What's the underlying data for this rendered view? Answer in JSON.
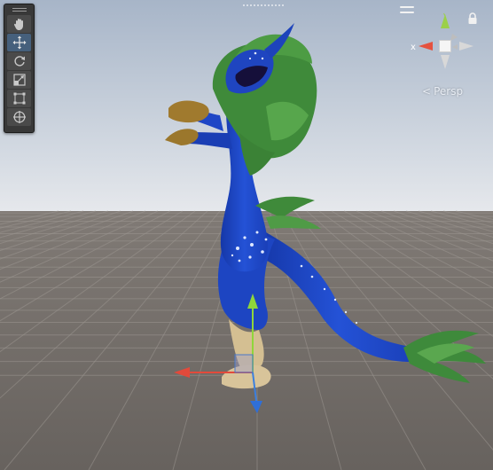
{
  "tools": {
    "items": [
      {
        "name": "hand-tool",
        "icon": "hand-icon",
        "active": false
      },
      {
        "name": "move-tool",
        "icon": "move-icon",
        "active": true
      },
      {
        "name": "rotate-tool",
        "icon": "rotate-icon",
        "active": false
      },
      {
        "name": "scale-tool",
        "icon": "scale-icon",
        "active": false
      },
      {
        "name": "rect-tool",
        "icon": "rect-transform-icon",
        "active": false
      },
      {
        "name": "transform-tool",
        "icon": "transform-icon",
        "active": false
      }
    ]
  },
  "gizmo": {
    "x_label": "x",
    "projection_label": "Persp",
    "colors": {
      "x": "#e5523f",
      "y": "#9bd04a",
      "z": "#3a7fe0",
      "neutral": "#d8d8d8"
    }
  },
  "scene": {
    "colors": {
      "sky_top": "#a9b7c9",
      "sky_horizon": "#e2e5ea",
      "ground": "#6e6a66",
      "body": "#1f47c8",
      "fur": "#3f8a3a",
      "beak": "#a07a2e",
      "claw": "#d8c49a"
    }
  }
}
